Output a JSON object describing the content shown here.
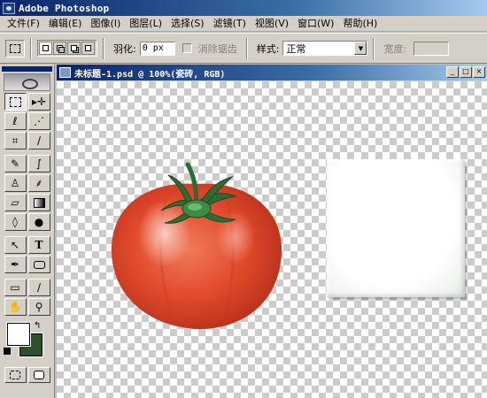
{
  "app": {
    "title": "Adobe Photoshop"
  },
  "menu": {
    "items": [
      "文件(F)",
      "编辑(E)",
      "图像(I)",
      "图层(L)",
      "选择(S)",
      "滤镜(T)",
      "视图(V)",
      "窗口(W)",
      "帮助(H)"
    ]
  },
  "options": {
    "feather_label": "羽化:",
    "feather_value": "0 px",
    "antialias_label": "消除锯齿",
    "style_label": "样式:",
    "style_value": "正常",
    "width_label": "宽度:"
  },
  "toolbox": {
    "foreground_color": "#ffffff",
    "background_color": "#2f4f2a"
  },
  "document": {
    "title": "未标题-1.psd @ 100%(瓷砖, RGB)"
  },
  "colors": {
    "titlebar_start": "#0a246a",
    "tomato_red": "#e24a2c",
    "stem_green": "#2f6b35"
  }
}
